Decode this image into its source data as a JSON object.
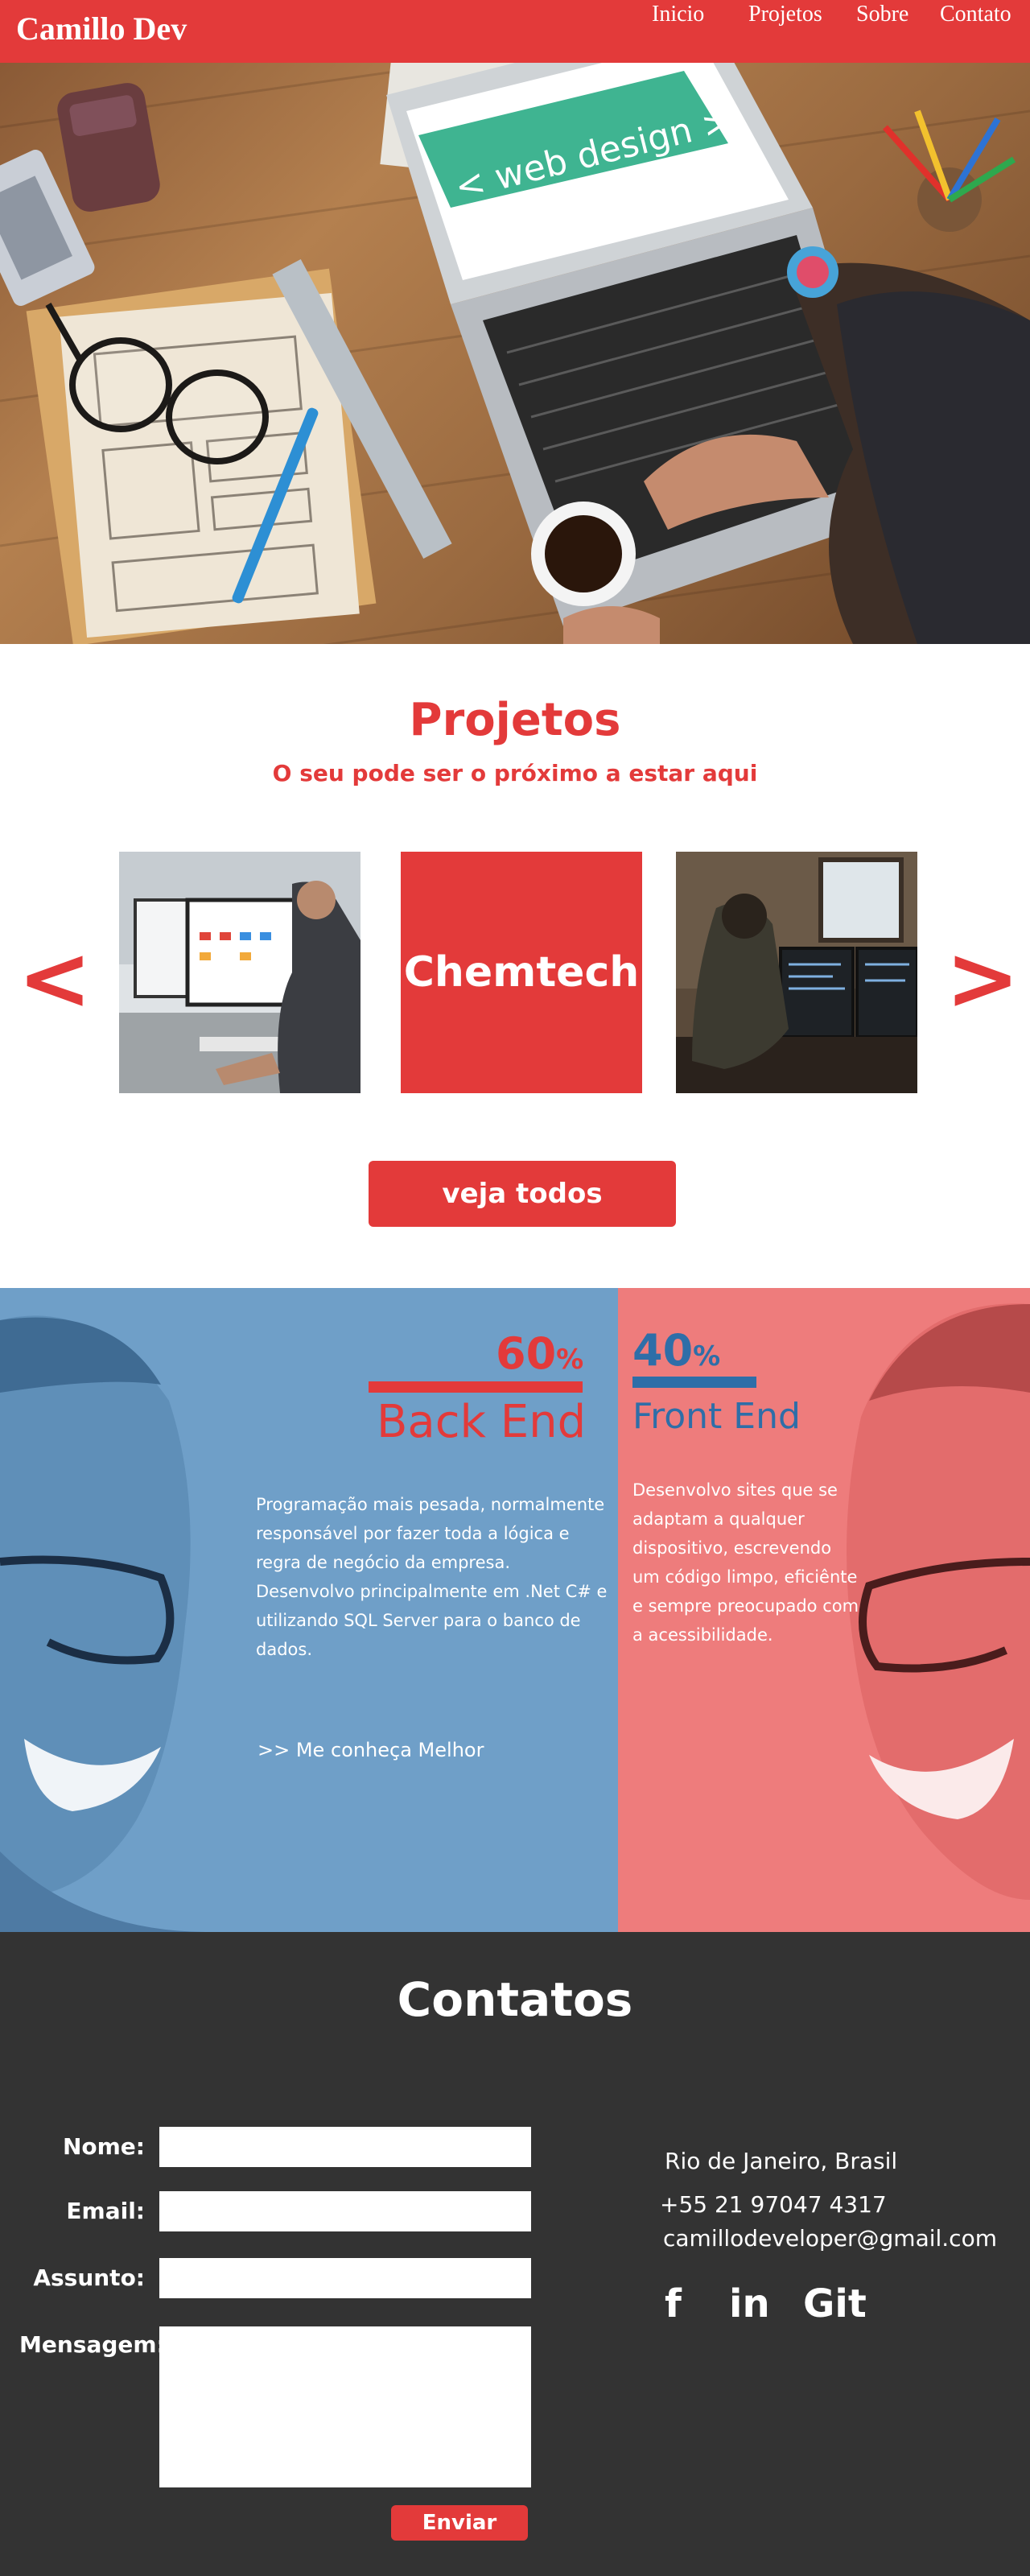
{
  "nav": {
    "brand": "Camillo Dev",
    "items": [
      {
        "label": "Inicio"
      },
      {
        "label": "Projetos"
      },
      {
        "label": "Sobre"
      },
      {
        "label": "Contato"
      }
    ]
  },
  "hero": {
    "laptop_text": "< web design >"
  },
  "projects": {
    "title": "Projetos",
    "subtitle": "O seu pode ser o próximo a estar aqui",
    "prev_label": "<",
    "next_label": ">",
    "card_label": "Chemtech",
    "button": "veja todos"
  },
  "skills": {
    "backend": {
      "percent": "60",
      "percent_sign": "%",
      "percent_value": 60,
      "label": "Back End",
      "description": "Programação mais pesada, normalmente responsável por fazer toda a lógica e regra de negócio da empresa. Desenvolvo principalmente  em  .Net C# e utilizando SQL Server para o banco de dados.",
      "link": ">>  Me conheça Melhor"
    },
    "frontend": {
      "percent": "40",
      "percent_sign": "%",
      "percent_value": 40,
      "label": "Front End",
      "description": "Desenvolvo sites que se adaptam a qualquer dispositivo, escrevendo um código limpo, eficiênte e sempre preocupado com a acessibilidade."
    }
  },
  "contact": {
    "title": "Contatos",
    "form": {
      "name_label": "Nome:",
      "email_label": "Email:",
      "subject_label": "Assunto:",
      "message_label": "Mensagem:",
      "submit": "Enviar"
    },
    "info": {
      "location": "Rio de Janeiro, Brasil",
      "phone": "+55 21 97047 4317",
      "email": "camillodeveloper@gmail.com"
    },
    "social": {
      "facebook": "f",
      "linkedin": "in",
      "git": "Git"
    }
  },
  "colors": {
    "brand_red": "#e33a3a",
    "skills_blue": "#6f9fc8",
    "skills_pink": "#ee7c7c",
    "accent_blue": "#2e6ea8",
    "footer_dark": "#333333"
  }
}
